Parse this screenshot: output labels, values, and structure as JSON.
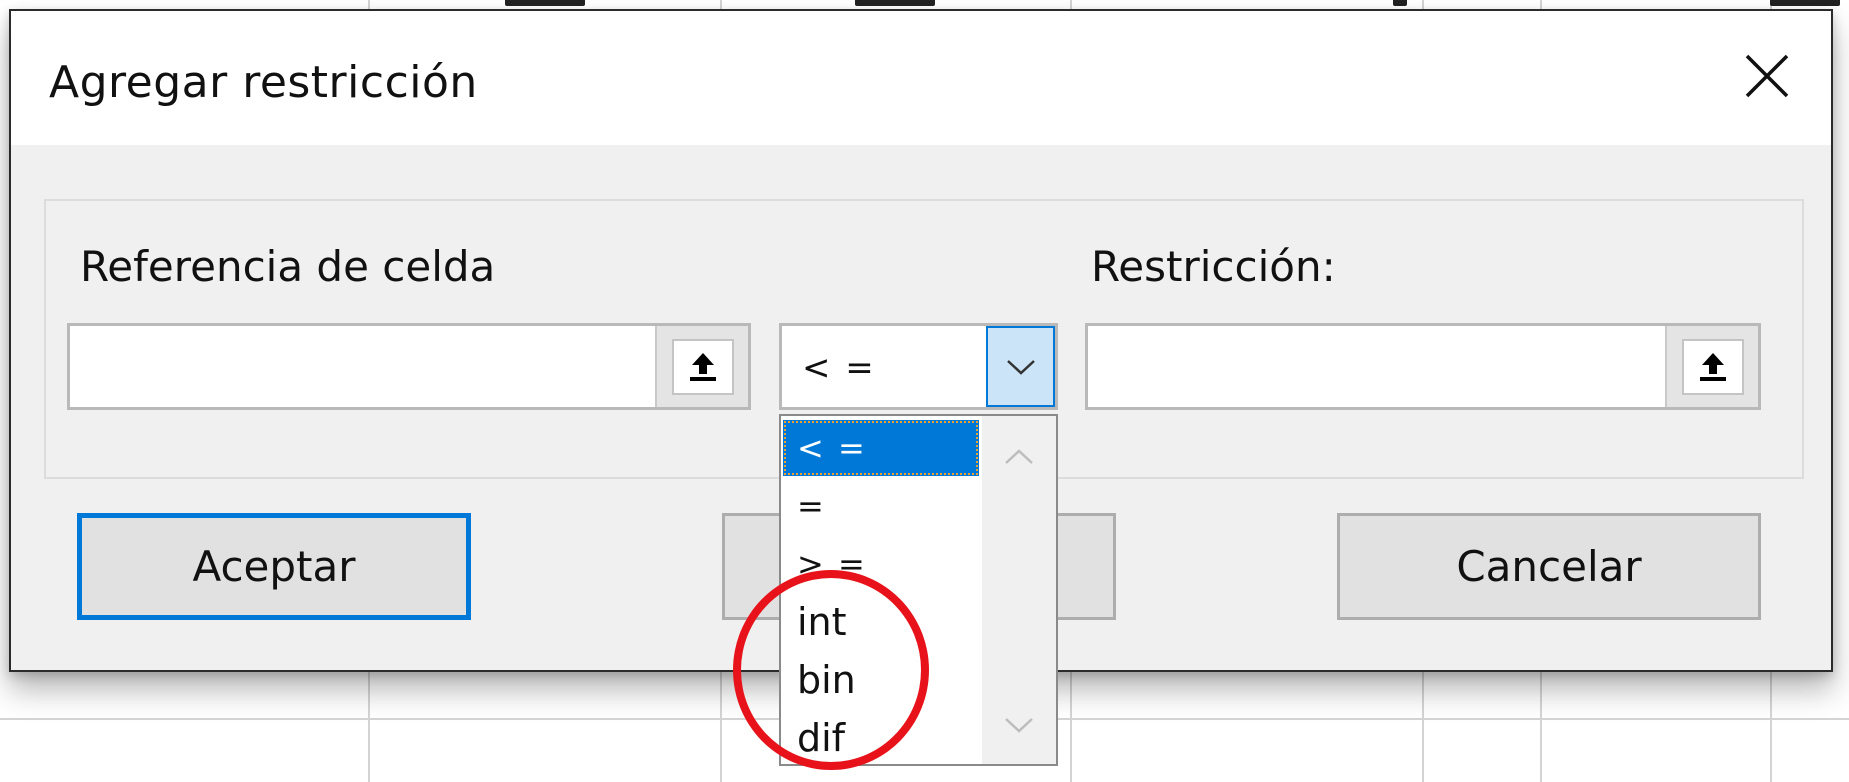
{
  "dialog": {
    "title": "Agregar restricción"
  },
  "fields": {
    "cell_reference_label": "Referencia de celda",
    "cell_reference_value": "",
    "constraint_label": "Restricción:",
    "constraint_value": ""
  },
  "operator": {
    "selected": "< =",
    "options": [
      "< =",
      "=",
      "> =",
      "int",
      "bin",
      "dif"
    ]
  },
  "buttons": {
    "accept": "Aceptar",
    "cancel": "Cancelar",
    "add": ""
  },
  "colors": {
    "accent": "#0078d7",
    "annotation": "#e8131a"
  },
  "icons": {
    "close": "close-icon",
    "collapse": "collapse-dialog-icon",
    "dropdown": "chevron-down-icon",
    "scroll_up": "chevron-up-icon",
    "scroll_down": "chevron-down-icon"
  }
}
